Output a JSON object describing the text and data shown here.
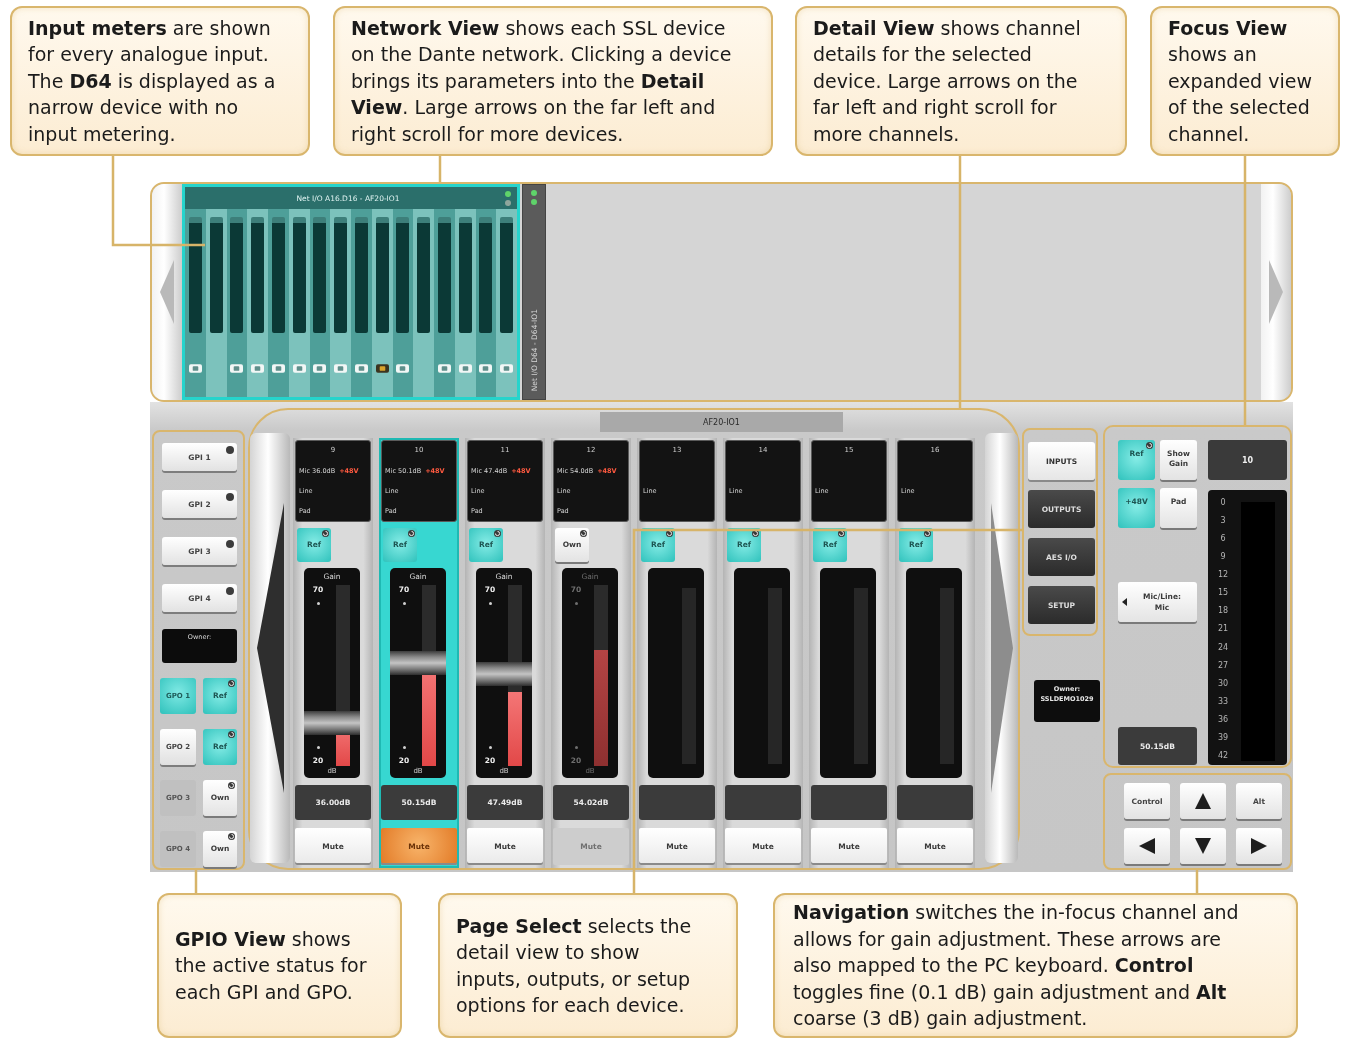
{
  "callouts_top": [
    {
      "text": "**Input meters** are shown for every analogue input. The **D64** is displayed as a narrow device with no input metering."
    },
    {
      "text": "**Network View** shows each SSL device on the Dante network. Clicking a device brings its parameters into the **Detail View**. Large arrows on the far left and right scroll for more devices."
    },
    {
      "text": "**Detail View** shows channel details for the selected device. Large arrows on the far left and right scroll for more channels."
    },
    {
      "text": "**Focus View** shows an expanded view of the selected channel."
    }
  ],
  "network_view": {
    "devices": [
      {
        "kind": "wide",
        "title": "Net I/O A16.D16 - AF20-IO1",
        "selected": true,
        "status_lights": [
          {
            "color": "#5fd36a"
          },
          {
            "color": "#8fa69c"
          }
        ],
        "inputs": [
          {
            "kind": "tag"
          },
          {
            "kind": "none"
          },
          {
            "kind": "tag"
          },
          {
            "kind": "tag"
          },
          {
            "kind": "tag"
          },
          {
            "kind": "tag"
          },
          {
            "kind": "tag"
          },
          {
            "kind": "tag"
          },
          {
            "kind": "tag"
          },
          {
            "kind": "alert"
          },
          {
            "kind": "tag"
          },
          {
            "kind": "none"
          },
          {
            "kind": "tag"
          },
          {
            "kind": "tag"
          },
          {
            "kind": "tag"
          },
          {
            "kind": "tag"
          }
        ]
      },
      {
        "kind": "narrow",
        "title": "Net I/O D64 - D64-IO1",
        "selected": false,
        "status_lights": [
          {
            "color": "#5fd36a"
          },
          {
            "color": "#5fd36a"
          }
        ]
      }
    ]
  },
  "gpio_view": {
    "inputs": [
      {
        "label": "GPI 1",
        "on": false
      },
      {
        "label": "GPI 2",
        "on": false
      },
      {
        "label": "GPI 3",
        "on": false
      },
      {
        "label": "GPI 4",
        "on": false
      }
    ],
    "owner_label": "Owner:",
    "outputs": [
      {
        "label": "GPO 1",
        "on": true,
        "disabled": false,
        "tag": {
          "label": "Ref",
          "on": true
        }
      },
      {
        "label": "GPO 2",
        "on": false,
        "disabled": false,
        "tag": {
          "label": "Ref",
          "on": true
        }
      },
      {
        "label": "GPO 3",
        "on": false,
        "disabled": true,
        "tag": {
          "label": "Own",
          "on": false
        }
      },
      {
        "label": "GPO 4",
        "on": false,
        "disabled": true,
        "tag": {
          "label": "Own",
          "on": false
        }
      }
    ]
  },
  "detail_view": {
    "device": "AF20-IO1",
    "channels": [
      {
        "kind": "mic",
        "number": "9",
        "selected": false,
        "locked": false,
        "input": "Mic 36.0dB",
        "phantom": "+48V",
        "mode": "Line",
        "pad": "Pad",
        "tag": {
          "label": "Ref",
          "on": true
        },
        "gain_label": "Gain",
        "gain_max": "70",
        "gain_min": "20",
        "gain_unit": "dB",
        "gain": {
          "level": 0.2
        },
        "meter": {
          "level": 0.23
        },
        "readout": "36.00dB",
        "mute": {
          "label": "Mute",
          "on": false
        }
      },
      {
        "kind": "mic",
        "number": "10",
        "selected": true,
        "locked": false,
        "input": "Mic 50.1dB",
        "phantom": "+48V",
        "mode": "Line",
        "pad": "Pad",
        "tag": {
          "label": "Ref",
          "on": true
        },
        "gain_label": "Gain",
        "gain_max": "70",
        "gain_min": "20",
        "gain_unit": "dB",
        "gain": {
          "level": 0.58
        },
        "meter": {
          "level": 0.55
        },
        "readout": "50.15dB",
        "mute": {
          "label": "Mute",
          "on": true
        }
      },
      {
        "kind": "mic",
        "number": "11",
        "selected": false,
        "locked": false,
        "input": "Mic 47.4dB",
        "phantom": "+48V",
        "mode": "Line",
        "pad": "Pad",
        "tag": {
          "label": "Ref",
          "on": true
        },
        "gain_label": "Gain",
        "gain_max": "70",
        "gain_min": "20",
        "gain_unit": "dB",
        "gain": {
          "level": 0.51
        },
        "meter": {
          "level": 0.41
        },
        "readout": "47.49dB",
        "mute": {
          "label": "Mute",
          "on": false
        }
      },
      {
        "kind": "mic",
        "number": "12",
        "selected": false,
        "locked": true,
        "input": "Mic 54.0dB",
        "phantom": "+48V",
        "mode": "Line",
        "pad": "Pad",
        "tag": {
          "label": "Own",
          "on": false
        },
        "gain_label": "Gain",
        "gain_max": "70",
        "gain_min": "20",
        "gain_unit": "dB",
        "meter": {
          "level": 0.64
        },
        "readout": "54.02dB",
        "mute": {
          "label": "Mute",
          "on": false
        }
      },
      {
        "kind": "line",
        "number": "13",
        "selected": false,
        "locked": false,
        "mode": "Line",
        "tag": {
          "label": "Ref",
          "on": true
        },
        "mute": {
          "label": "Mute",
          "on": false
        }
      },
      {
        "kind": "line",
        "number": "14",
        "selected": false,
        "locked": false,
        "mode": "Line",
        "tag": {
          "label": "Ref",
          "on": true
        },
        "mute": {
          "label": "Mute",
          "on": false
        }
      },
      {
        "kind": "line",
        "number": "15",
        "selected": false,
        "locked": false,
        "mode": "Line",
        "tag": {
          "label": "Ref",
          "on": true
        },
        "mute": {
          "label": "Mute",
          "on": false
        }
      },
      {
        "kind": "line",
        "number": "16",
        "selected": false,
        "locked": false,
        "mode": "Line",
        "tag": {
          "label": "Ref",
          "on": true
        },
        "mute": {
          "label": "Mute",
          "on": false
        }
      }
    ]
  },
  "page_select": {
    "pages": [
      {
        "label": "INPUTS",
        "selected": true
      },
      {
        "label": "OUTPUTS",
        "selected": false
      },
      {
        "label": "AES I/O",
        "selected": false
      },
      {
        "label": "SETUP",
        "selected": false
      }
    ],
    "owner_label": "Owner:",
    "owner_name": "SSLDEMO1029"
  },
  "focus_view": {
    "buttons": [
      {
        "kind": "tag",
        "label": "Ref",
        "on": true
      },
      {
        "kind": "toggle",
        "label": "Show Gain",
        "on": false
      },
      {
        "kind": "toggle",
        "label": "+48V",
        "on": true
      },
      {
        "kind": "toggle",
        "label": "Pad",
        "on": false
      }
    ],
    "channel": "10",
    "source_label": "Mic/Line:",
    "source_value": "Mic",
    "readout": "50.15dB",
    "scale": [
      "0",
      "3",
      "6",
      "9",
      "12",
      "15",
      "18",
      "21",
      "24",
      "27",
      "30",
      "33",
      "36",
      "39",
      "42"
    ]
  },
  "navigation": {
    "buttons": [
      {
        "kind": "control",
        "label": "Control"
      },
      {
        "kind": "up"
      },
      {
        "kind": "alt",
        "label": "Alt"
      },
      {
        "kind": "left"
      },
      {
        "kind": "down"
      },
      {
        "kind": "right"
      }
    ]
  },
  "callouts_bottom": [
    {
      "text": "**GPIO View** shows the active status for each GPI and GPO."
    },
    {
      "text": "**Page Select** selects the detail view to show inputs, outputs, or setup options for each device."
    },
    {
      "text": "**Navigation** switches the in-focus channel and allows for gain adjustment. These arrows are also mapped to the PC keyboard. **Control** toggles fine (0.1 dB) gain adjustment and **Alt** coarse (3 dB) gain adjustment."
    }
  ]
}
